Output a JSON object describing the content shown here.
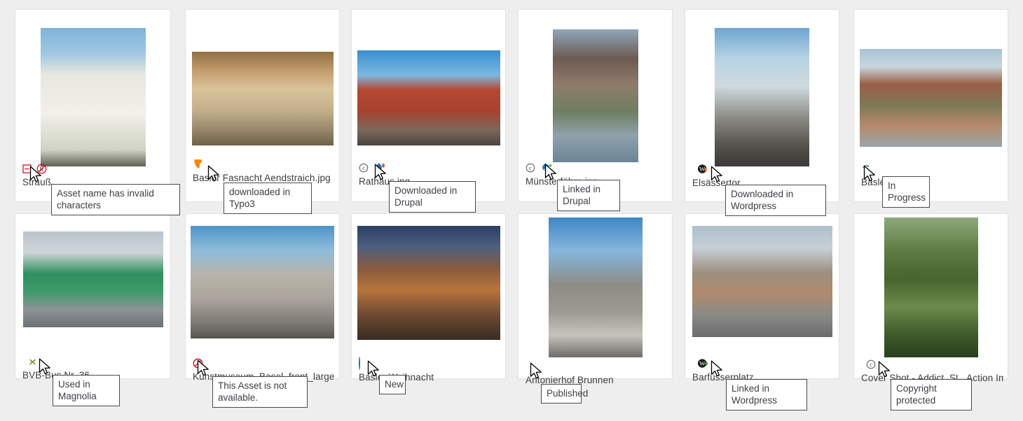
{
  "theme": {
    "page_bg": "#eeeeee",
    "card_bg": "#ffffff",
    "card_border": "#e2e2e2",
    "label_color": "#3c3c3c",
    "tooltip_bg": "#ffffff",
    "tooltip_border": "#4a4a4a",
    "tooltip_text": "#3f3f46",
    "status_published": "#1f5f8b",
    "status_new": "#2b6ea8",
    "status_inprogress": "#2b6ea8",
    "error_red": "#d0021b",
    "magnolia_green": "#6f9e2c",
    "typo3_orange": "#ff8700",
    "drupal_blue": "#0678be",
    "wordpress_black": "#21759b"
  },
  "assets": [
    {
      "id": "strauss",
      "label": "Strauß",
      "badges": [
        {
          "name": "invalid-name-icon",
          "type": "red-square-minus"
        },
        {
          "name": "no-rights-icon",
          "type": "red-circle-crossed-r"
        }
      ],
      "tooltip": "Asset name has invalid\ncharacters",
      "thumb_alt": "white cherry blossom flowers against blue sky"
    },
    {
      "id": "basler-fasnacht-aendstraich",
      "label": "Basler Fasnacht Aendstraich.jpg",
      "badges": [
        {
          "name": "typo3-downloaded-icon",
          "type": "typo3"
        }
      ],
      "tooltip": "downloaded in Typo3",
      "thumb_alt": "Basel carnival parade with red masked costumes"
    },
    {
      "id": "rathaus",
      "label": "Rathaus.jpg",
      "badges": [
        {
          "name": "copyright-icon",
          "type": "copyright"
        },
        {
          "name": "drupal-downloaded-icon",
          "type": "drupal-download"
        }
      ],
      "tooltip": "Downloaded in\nDrupal",
      "thumb_alt": "Basel red town hall Rathaus and market square"
    },
    {
      "id": "muensterfaehre",
      "label": "Münsterfähre.jpg",
      "badges": [
        {
          "name": "copyright-icon",
          "type": "copyright"
        },
        {
          "name": "drupal-linked-icon",
          "type": "drupal-link"
        }
      ],
      "tooltip": "Linked in\nDrupal",
      "thumb_alt": "Basel Münster cathedral above Rhine with ferry boat"
    },
    {
      "id": "elsaessertor",
      "label": "Elsässertor",
      "badges": [
        {
          "name": "status-published-icon",
          "type": "dot-filled"
        },
        {
          "name": "wordpress-downloaded-icon",
          "type": "wordpress-download"
        }
      ],
      "tooltip": "Downloaded in\nWordpress",
      "thumb_alt": "modern glass office building beside railway tracks"
    },
    {
      "id": "basler-muenster",
      "label": "Basler Münster",
      "badges": [
        {
          "name": "status-in-progress-icon",
          "type": "sync"
        }
      ],
      "tooltip": "In Progress",
      "thumb_alt": "Basel Münster cathedral seen from across the Rhine"
    },
    {
      "id": "bvb-bus-nr-36",
      "label": "BVB-Bus Nr. 36",
      "badges": [
        {
          "name": "status-published-icon",
          "type": "dot-filled"
        },
        {
          "name": "magnolia-used-icon",
          "type": "magnolia"
        }
      ],
      "tooltip": "Used in Magnolia",
      "thumb_alt": "green Basel BVB trolley bus on city street"
    },
    {
      "id": "kunstmuseum-basel-front-large",
      "label": "Kunstmuseum_Basel_front_large.jpg",
      "badges": [
        {
          "name": "asset-unavailable-icon",
          "type": "no-entry"
        }
      ],
      "tooltip": "This Asset is not\navailable.",
      "thumb_alt": "Kunstmuseum Basel modern stone facade"
    },
    {
      "id": "basler-weihnacht",
      "label": "Basler Weihnacht",
      "badges": [
        {
          "name": "status-new-icon",
          "type": "dot-hollow"
        }
      ],
      "tooltip": "New",
      "thumb_alt": "Basel Christmas market at dusk with lit tree"
    },
    {
      "id": "antonierhof-brunnen",
      "label": "Antonierhof Brunnen",
      "badges": [
        {
          "name": "status-published-icon",
          "type": "dot-filled"
        }
      ],
      "tooltip": "Published",
      "thumb_alt": "stone fountain in front of curved grey building"
    },
    {
      "id": "barfuesserplatz",
      "label": "Barfüsserplatz",
      "badges": [
        {
          "name": "status-published-icon",
          "type": "dot-filled"
        },
        {
          "name": "wordpress-linked-icon",
          "type": "wordpress-link"
        }
      ],
      "tooltip": "Linked in\nWordpress",
      "thumb_alt": "Barfüsserplatz square with tram and historic buildings"
    },
    {
      "id": "cover-shot-addict",
      "label": "Cover Shot - Addict_SL_Action Image_...",
      "badges": [
        {
          "name": "status-published-icon",
          "type": "dot-filled"
        },
        {
          "name": "copyright-icon",
          "type": "copyright"
        }
      ],
      "tooltip": "Copyright protected",
      "thumb_alt": "mountain road winding through green alpine cliffs"
    }
  ]
}
